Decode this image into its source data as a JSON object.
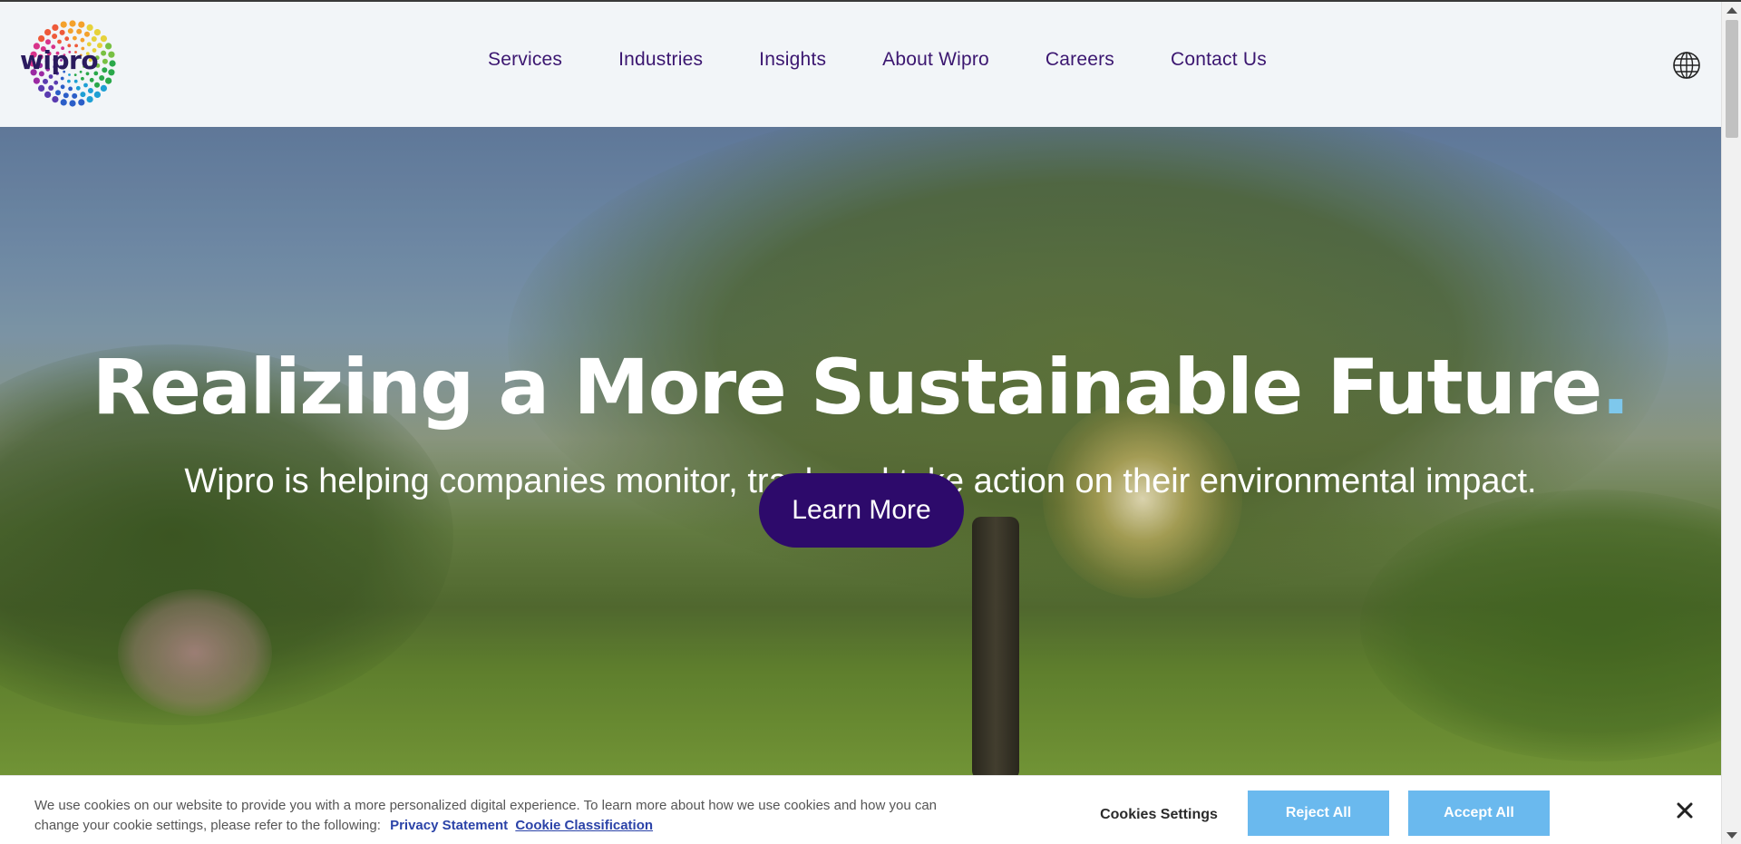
{
  "header": {
    "logo_text": "wipro",
    "nav": [
      {
        "label": "Services"
      },
      {
        "label": "Industries"
      },
      {
        "label": "Insights"
      },
      {
        "label": "About Wipro"
      },
      {
        "label": "Careers"
      },
      {
        "label": "Contact Us"
      }
    ],
    "globe_icon": "globe-icon"
  },
  "hero": {
    "title": "Realizing a More Sustainable Future",
    "title_dot": ".",
    "subtitle": "Wipro is helping companies monitor, track and take action on their environmental impact.",
    "cta_label": "Learn More"
  },
  "cookie_banner": {
    "text": "We use cookies on our website to provide you with a more personalized digital experience. To learn more about how we use cookies and how you can change your cookie settings, please refer to the following:",
    "privacy_link": "Privacy Statement",
    "classification_link": "Cookie Classification",
    "settings_label": "Cookies Settings",
    "reject_label": "Reject All",
    "accept_label": "Accept All",
    "close_icon": "close-icon"
  },
  "colors": {
    "nav_text": "#3b1670",
    "cta_bg": "#2d0a6b",
    "cookie_buttons": "#6ab9ee",
    "title_dot": "#7ec8ec"
  }
}
